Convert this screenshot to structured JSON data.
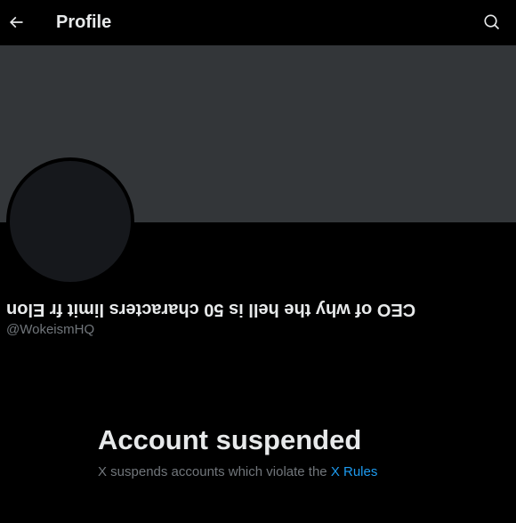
{
  "header": {
    "title": "Profile",
    "back_icon": "arrow-left-icon",
    "search_icon": "search-icon"
  },
  "profile": {
    "display_name": "CEO of why the hell is 50 characters limit fr Elon",
    "handle": "@WokeismHQ"
  },
  "suspension": {
    "title": "Account suspended",
    "message": "X suspends accounts which violate the",
    "rules_link": "X Rules"
  },
  "colors": {
    "background": "#000000",
    "banner": "#333639",
    "avatar": "#16181c",
    "primary_text": "#e7e9ea",
    "secondary_text": "#71767b",
    "link": "#1d9bf0"
  }
}
